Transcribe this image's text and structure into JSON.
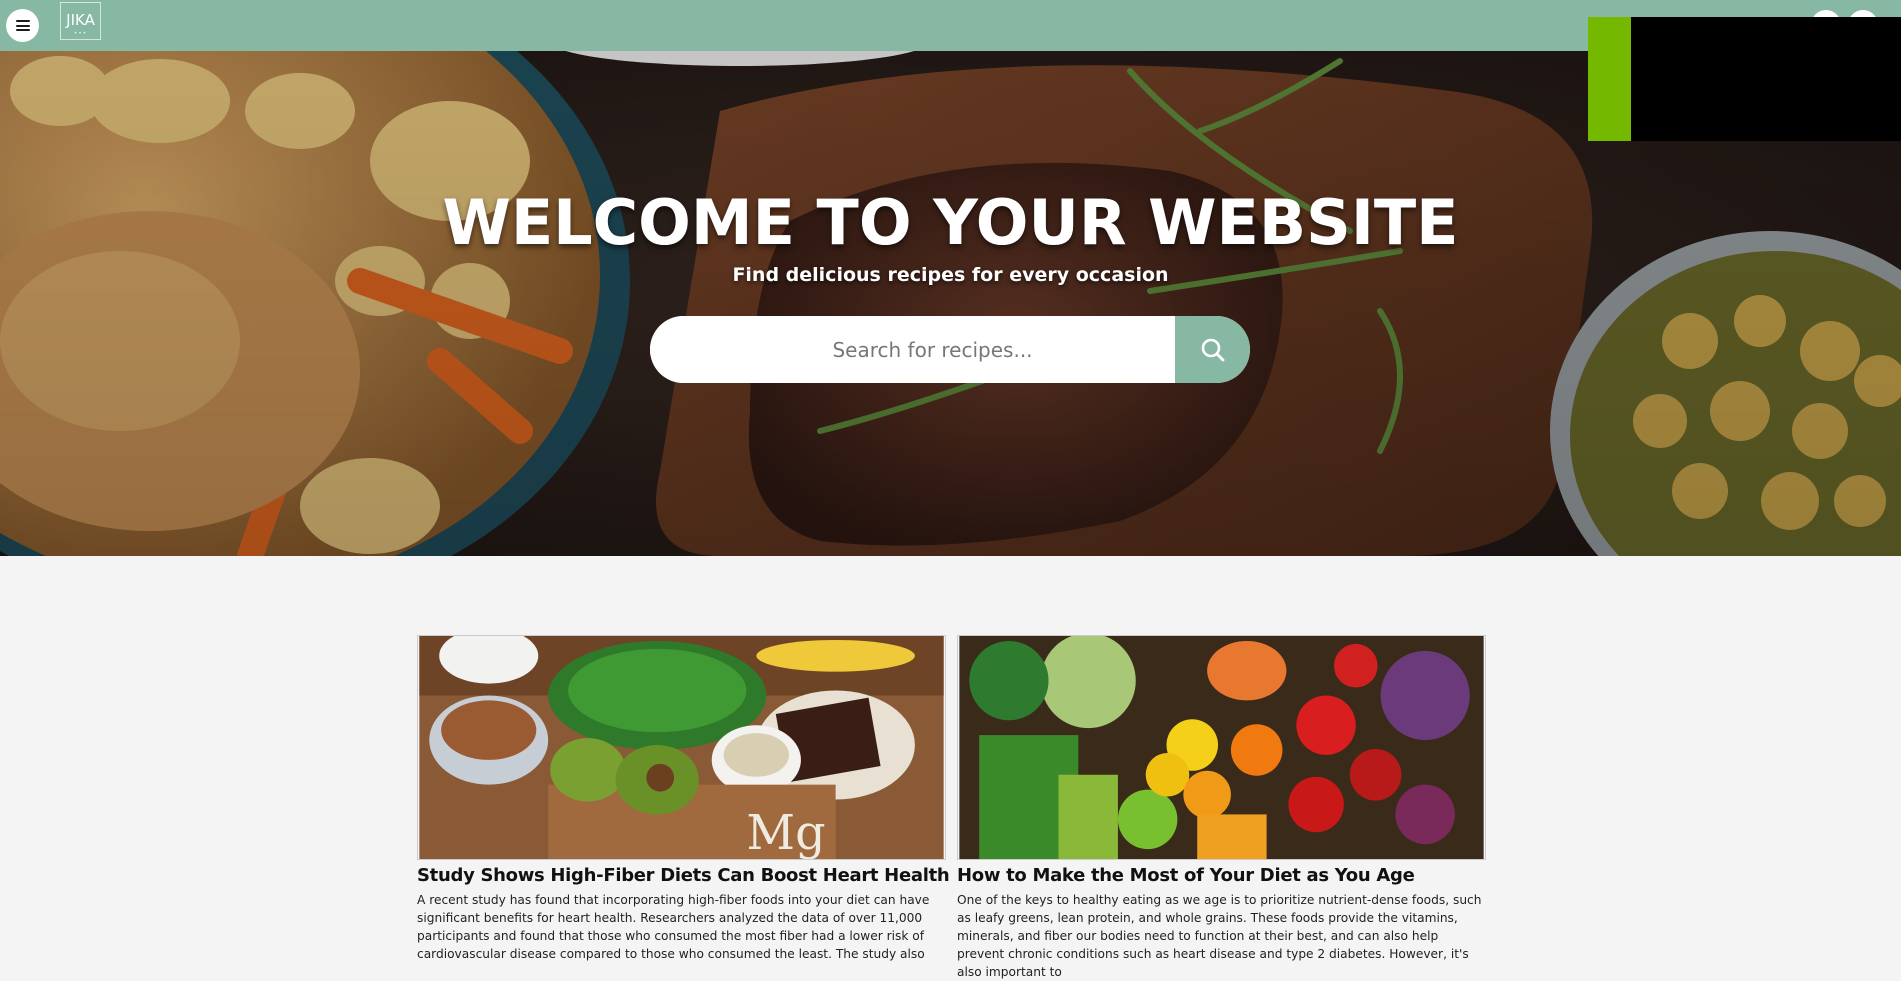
{
  "header": {
    "logo_text": "JIKA",
    "logo_dots": "•••",
    "menu_icon": "hamburger-menu-icon",
    "background_color": "#86b8a4"
  },
  "hero": {
    "title": "WELCOME TO YOUR WEBSITE",
    "subtitle": "Find delicious recipes for every occasion",
    "search": {
      "placeholder": "Search for recipes...",
      "value": "",
      "button_icon": "search-icon"
    }
  },
  "ad": {
    "accent_color": "#74b800",
    "fill_color": "#000000"
  },
  "articles": [
    {
      "title": "Study Shows High-Fiber Diets Can Boost Heart Health",
      "excerpt": "A recent study has found that incorporating high-fiber foods into your diet can have significant benefits for heart health. Researchers analyzed the data of over 11,000 participants and found that those who consumed the most fiber had a lower risk of cardiovascular disease compared to those who consumed the least. The study also"
    },
    {
      "title": "How to Make the Most of Your Diet as You Age",
      "excerpt": "One of the keys to healthy eating as we age is to prioritize nutrient-dense foods, such as leafy greens, lean protein, and whole grains. These foods provide the vitamins, minerals, and fiber our bodies need to function at their best, and can also help prevent chronic conditions such as heart disease and type 2 diabetes. However, it's also important to"
    }
  ]
}
